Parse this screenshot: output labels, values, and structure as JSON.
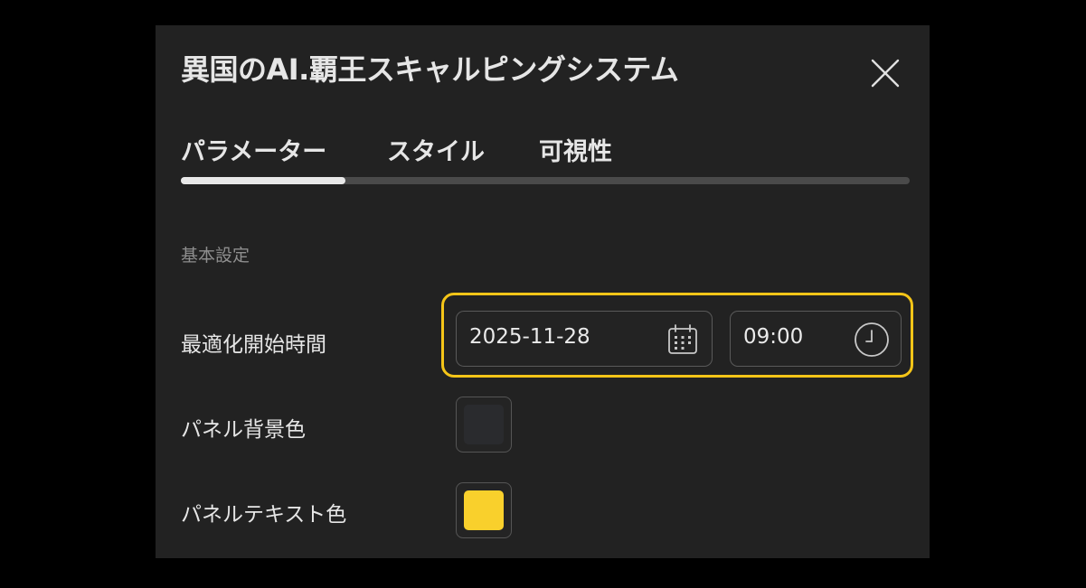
{
  "dialog": {
    "title": "異国のAI.覇王スキャルピングシステム",
    "close_icon": "close-icon"
  },
  "tabs": [
    {
      "label": "パラメーター",
      "active": true
    },
    {
      "label": "スタイル",
      "active": false
    },
    {
      "label": "可視性",
      "active": false
    }
  ],
  "section": {
    "title": "基本設定"
  },
  "settings": {
    "optimize_start": {
      "label": "最適化開始時間",
      "date_value": "2025-11-28",
      "date_icon": "calendar-icon",
      "time_value": "09:00",
      "time_icon": "clock-icon"
    },
    "panel_background": {
      "label": "パネル背景色",
      "color": "#2a2b2e"
    },
    "panel_text": {
      "label": "パネルテキスト色",
      "color": "#f9d02c"
    }
  },
  "colors": {
    "highlight": "#f5c518",
    "dialog_bg": "#222222",
    "text": "#e6e6e6"
  }
}
